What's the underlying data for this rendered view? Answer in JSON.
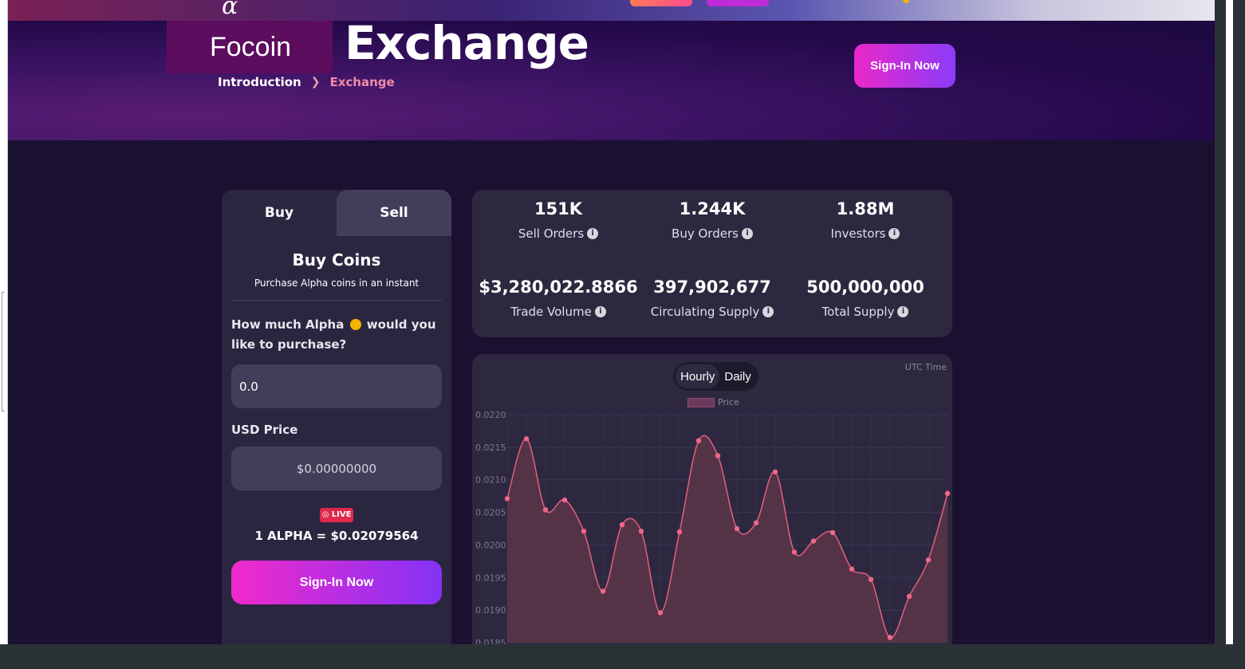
{
  "brand": {
    "name": "Focoin"
  },
  "hero": {
    "title": "Exchange",
    "breadcrumb": {
      "home": "Introduction",
      "current": "Exchange"
    },
    "signin_label": "Sign-In Now"
  },
  "trade": {
    "tabs": [
      {
        "label": "Buy"
      },
      {
        "label": "Sell"
      }
    ],
    "heading": "Buy Coins",
    "subheading": "Purchase Alpha coins in an instant",
    "question_part1": "How much Alpha",
    "question_part2": "would you like to purchase?",
    "amount_value": "0.0",
    "usd_label": "USD Price",
    "usd_value": "$0.00000000",
    "live_label": "◎ LIVE",
    "rate": "1 ALPHA = $0.02079564",
    "signin_label": "Sign-In Now"
  },
  "stats": [
    {
      "value": "151K",
      "label": "Sell Orders"
    },
    {
      "value": "1.244K",
      "label": "Buy Orders"
    },
    {
      "value": "1.88M",
      "label": "Investors"
    },
    {
      "value": "$3,280,022.8866",
      "label": "Trade Volume"
    },
    {
      "value": "397,902,677",
      "label": "Circulating Supply"
    },
    {
      "value": "500,000,000",
      "label": "Total Supply"
    }
  ],
  "chart": {
    "toggle": {
      "hourly": "Hourly",
      "daily": "Daily",
      "selected": "Hourly"
    },
    "utc_label": "UTC Time",
    "legend_label": "Price"
  },
  "chart_data": {
    "type": "area",
    "series": [
      {
        "name": "Price",
        "values": [
          0.02071,
          0.02163,
          0.02054,
          0.02069,
          0.02021,
          0.01929,
          0.02031,
          0.02021,
          0.01896,
          0.0202,
          0.0216,
          0.02137,
          0.02025,
          0.02034,
          0.02112,
          0.01989,
          0.02006,
          0.02019,
          0.01963,
          0.01947,
          0.01858,
          0.01921,
          0.01977,
          0.02079
        ]
      }
    ],
    "ylim": [
      0.0185,
      0.022
    ],
    "yticks": [
      "0.0220",
      "0.0215",
      "0.0210",
      "0.0205",
      "0.0200",
      "0.0195",
      "0.0190",
      "0.0185"
    ],
    "grid": true,
    "legend": "top-center",
    "colors": {
      "line": "#e0607e",
      "fill": "#5a3448",
      "point": "#f06888"
    }
  }
}
